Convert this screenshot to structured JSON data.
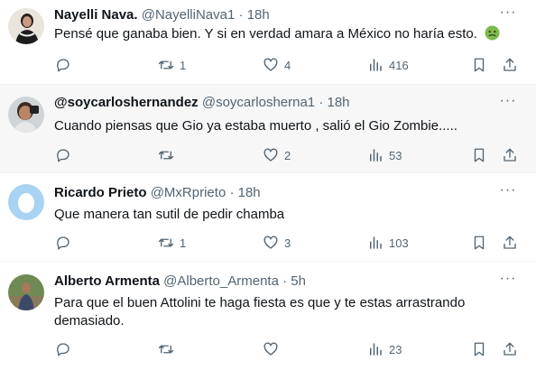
{
  "tweets": [
    {
      "name": "Nayelli Nava.",
      "handle": "@NayelliNava1",
      "dot": "·",
      "time": "18h",
      "text": "Pensé que ganaba bien. Y si en verdad amara a México no haría esto.",
      "emoji_icon": "nauseated-face-icon",
      "replies": "",
      "retweets": "1",
      "likes": "4",
      "views": "416"
    },
    {
      "name": "@soycarloshernandez",
      "handle": "@soycarloshernа1",
      "dot": "·",
      "time": "18h",
      "text": "Cuando piensas que Gio ya estaba muerto , salió el Gio Zombie.....",
      "replies": "",
      "retweets": "",
      "likes": "2",
      "views": "53"
    },
    {
      "name": "Ricardo Prieto",
      "handle": "@MxRprieto",
      "dot": "·",
      "time": "18h",
      "text": "Que manera tan sutil de pedir chamba",
      "replies": "",
      "retweets": "1",
      "likes": "3",
      "views": "103"
    },
    {
      "name": "Alberto Armenta",
      "handle": "@Alberto_Armenta",
      "dot": "·",
      "time": "5h",
      "text": "Para que el buen Attolini te haga fiesta es que y te estas arrastrando demasiado.",
      "replies": "",
      "retweets": "",
      "likes": "",
      "views": "23"
    }
  ],
  "more_label": "···",
  "colors": {
    "text": "#0f1419",
    "secondary": "#536471",
    "divider": "#eff3f4",
    "hover_background": "#f7f7f7"
  }
}
